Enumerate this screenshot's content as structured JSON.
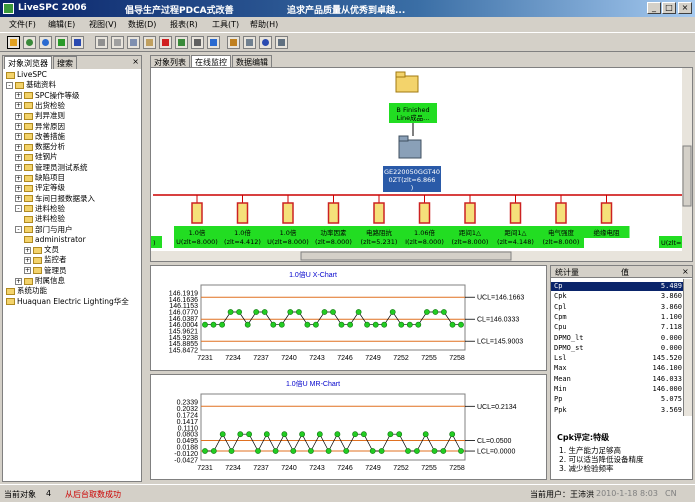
{
  "window": {
    "app_name": "LiveSPC 2006",
    "slogan_1": "倡导生产过程PDCA式改善",
    "slogan_2": "追求产品质量从优秀到卓越..."
  },
  "menu": [
    "文件(F)",
    "编辑(E)",
    "视图(V)",
    "数据(D)",
    "报表(R)",
    "工具(T)",
    "帮助(H)"
  ],
  "left_panel": {
    "tabs": [
      "对象浏览器",
      "搜索"
    ],
    "close_glyph": "×",
    "tree": [
      {
        "label": "LiveSPC",
        "level": 0,
        "toggle": ""
      },
      {
        "label": "基础资料",
        "level": 0,
        "toggle": "-"
      },
      {
        "label": "SPC操作等级",
        "level": 1,
        "toggle": "+"
      },
      {
        "label": "出货检验",
        "level": 1,
        "toggle": "+"
      },
      {
        "label": "判异准则",
        "level": 1,
        "toggle": "+"
      },
      {
        "label": "异常原因",
        "level": 1,
        "toggle": "+"
      },
      {
        "label": "改善措施",
        "level": 1,
        "toggle": "+"
      },
      {
        "label": "数据分析",
        "level": 1,
        "toggle": "+"
      },
      {
        "label": "硅钢片",
        "level": 1,
        "toggle": "+"
      },
      {
        "label": "管理员测试系统",
        "level": 1,
        "toggle": "+"
      },
      {
        "label": "缺陷项目",
        "level": 1,
        "toggle": "+"
      },
      {
        "label": "评定等级",
        "level": 1,
        "toggle": "+"
      },
      {
        "label": "车间日报数据录入",
        "level": 1,
        "toggle": "+"
      },
      {
        "label": "进料检验",
        "level": 1,
        "toggle": "-"
      },
      {
        "label": "进料检验",
        "level": 2,
        "toggle": ""
      },
      {
        "label": "部门与用户",
        "level": 1,
        "toggle": "-"
      },
      {
        "label": "administrator",
        "level": 2,
        "toggle": ""
      },
      {
        "label": "文员",
        "level": 2,
        "toggle": "+"
      },
      {
        "label": "监控者",
        "level": 2,
        "toggle": "+"
      },
      {
        "label": "管理员",
        "level": 2,
        "toggle": "+"
      },
      {
        "label": "附属信息",
        "level": 1,
        "toggle": "+"
      },
      {
        "label": "系统功能",
        "level": 0,
        "toggle": ""
      },
      {
        "label": "Huaquan Electric Lighting华全",
        "level": 0,
        "toggle": ""
      }
    ]
  },
  "top_tabs": [
    "对象列表",
    "在线监控",
    "数据编辑"
  ],
  "diagram": {
    "root_label_line1": "B Finished",
    "root_label_line2": "Line成品...",
    "mid_label_line1": "GE220050GGT40",
    "mid_label_line2": "0ZT(zlt=6.866",
    "mid_label_line3": ")",
    "left_edge_label": ")",
    "right_edge_label": "U(zlt=",
    "children": [
      {
        "l1": "1.0倍",
        "l2": "U(zlt=8.000)"
      },
      {
        "l1": "1.0倍",
        "l2": "(zlt=4.412)"
      },
      {
        "l1": "1.0倍",
        "l2": "U(zlt=8.000)"
      },
      {
        "l1": "功率因素",
        "l2": "(zlt=8.000)"
      },
      {
        "l1": "电路阻抗",
        "l2": "(zlt=5.231)"
      },
      {
        "l1": "1.06倍",
        "l2": "I(zlt=8.000)"
      },
      {
        "l1": "距间1△",
        "l2": "(zlt=8.000)"
      },
      {
        "l1": "距间1△",
        "l2": "(zlt=4.148)"
      },
      {
        "l1": "电气强度",
        "l2": "(zlt=8.000)"
      },
      {
        "l1": "绝缘电阻",
        "l2": ""
      }
    ]
  },
  "charts": {
    "xbar": {
      "title": "1.0倍U X-Chart",
      "ucl": "UCL=146.1663",
      "cl": "CL=146.0333",
      "lcl": "LCL=145.9003",
      "y_ticks": [
        "146.1919",
        "146.1636",
        "146.1153",
        "146.0770",
        "146.0387",
        "146.0004",
        "145.9621",
        "145.9238",
        "145.8855",
        "145.8472"
      ],
      "x_ticks": [
        "7231",
        "7234",
        "7237",
        "7240",
        "7243",
        "7246",
        "7249",
        "7252",
        "7255",
        "7258"
      ],
      "ucl_value": 146.1663,
      "cl_value": 146.0333,
      "lcl_value": 145.9003,
      "ylim": [
        145.8472,
        146.1919
      ],
      "values": [
        146.0004,
        146.0004,
        146.0004,
        146.077,
        146.077,
        146.0004,
        146.077,
        146.077,
        146.0004,
        146.0004,
        146.077,
        146.077,
        146.0004,
        146.0004,
        146.077,
        146.077,
        146.0004,
        146.0004,
        146.077,
        146.0004,
        146.0004,
        146.0004,
        146.077,
        146.0004,
        146.0004,
        146.0004,
        146.077,
        146.077,
        146.077,
        146.0004,
        146.0004
      ]
    },
    "mr": {
      "title": "1.0倍U MR-Chart",
      "ucl": "UCL=0.2134",
      "cl": "CL=0.0500",
      "lcl": "LCL=0.0000",
      "y_ticks": [
        "0.2339",
        "0.2032",
        "0.1724",
        "0.1417",
        "0.1110",
        "0.0803",
        "0.0495",
        "0.0188",
        "-0.0120",
        "-0.0427"
      ],
      "x_ticks": [
        "7231",
        "7234",
        "7237",
        "7240",
        "7243",
        "7246",
        "7249",
        "7252",
        "7255",
        "7258"
      ],
      "ucl_value": 0.2134,
      "cl_value": 0.05,
      "lcl_value": 0.0,
      "ylim": [
        -0.0427,
        0.2339
      ],
      "values": [
        0.0,
        0.0,
        0.0803,
        0.0,
        0.0803,
        0.0803,
        0.0,
        0.0803,
        0.0,
        0.0803,
        0.0,
        0.0803,
        0.0,
        0.0803,
        0.0,
        0.0803,
        0.0,
        0.0803,
        0.0803,
        0.0,
        0.0,
        0.0803,
        0.0803,
        0.0,
        0.0,
        0.0803,
        0.0,
        0.0,
        0.0803,
        0.0
      ]
    }
  },
  "stats": {
    "header_stat": "统计量",
    "header_value": "值",
    "rows": [
      {
        "name": "Cp",
        "value": "5.489",
        "selected": true
      },
      {
        "name": "Cpk",
        "value": "3.860"
      },
      {
        "name": "Cpl",
        "value": "3.860"
      },
      {
        "name": "Cpm",
        "value": "1.100"
      },
      {
        "name": "Cpu",
        "value": "7.118"
      },
      {
        "name": "DPMO_lt",
        "value": "0.000"
      },
      {
        "name": "DPMO_st",
        "value": "0.000"
      },
      {
        "name": "Lsl",
        "value": "145.520"
      },
      {
        "name": "Max",
        "value": "146.100"
      },
      {
        "name": "Mean",
        "value": "146.033"
      },
      {
        "name": "Min",
        "value": "146.000"
      },
      {
        "name": "Pp",
        "value": "5.075"
      },
      {
        "name": "Ppk",
        "value": "3.569"
      }
    ],
    "rating_title": "Cpk评定:特级",
    "advice": [
      "1. 生产能力足够高",
      "2. 可以适当降低设备精度",
      "3. 减少检验频率"
    ]
  },
  "status": {
    "label_current_object": "当前对象",
    "object_count": "4",
    "message": "从后台取数成功",
    "user": "当前用户：王沛洪",
    "datetime": "2010-1-18 8:03",
    "locale": "CN"
  }
}
